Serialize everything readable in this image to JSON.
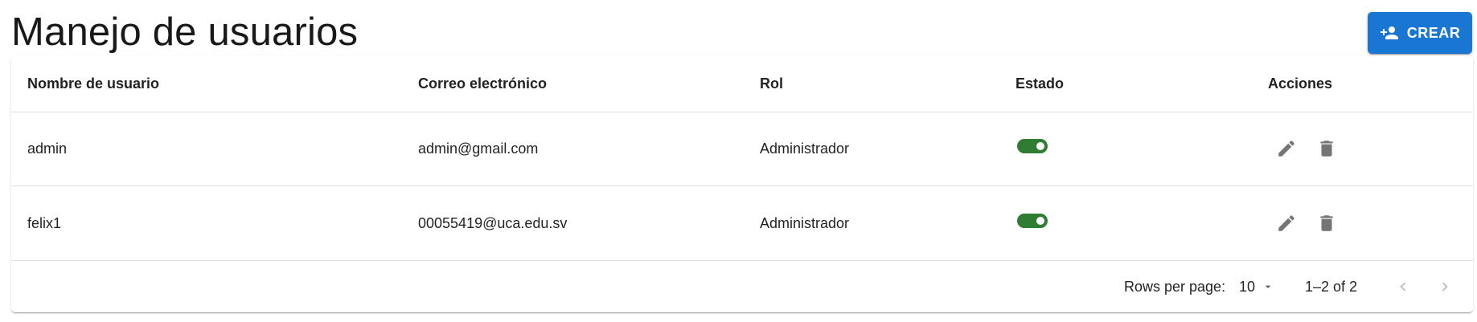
{
  "header": {
    "title": "Manejo de usuarios",
    "create_label": "CREAR"
  },
  "table": {
    "columns": [
      "Nombre de usuario",
      "Correo electrónico",
      "Rol",
      "Estado",
      "Acciones"
    ],
    "rows": [
      {
        "username": "admin",
        "email": "admin@gmail.com",
        "role": "Administrador",
        "active": true
      },
      {
        "username": "felix1",
        "email": "00055419@uca.edu.sv",
        "role": "Administrador",
        "active": true
      }
    ]
  },
  "pagination": {
    "rows_per_page_label": "Rows per page:",
    "rows_per_page_value": "10",
    "range_text": "1–2 of 2"
  },
  "icons": {
    "create": "person-add-icon",
    "edit": "pencil-icon",
    "delete": "trash-icon",
    "dropdown": "caret-down-icon",
    "prev": "chevron-left-icon",
    "next": "chevron-right-icon"
  },
  "colors": {
    "primary": "#1976d2",
    "switch_on": "#2e7d32",
    "icon_gray": "#757575",
    "disabled_nav": "#bdbdbd"
  }
}
